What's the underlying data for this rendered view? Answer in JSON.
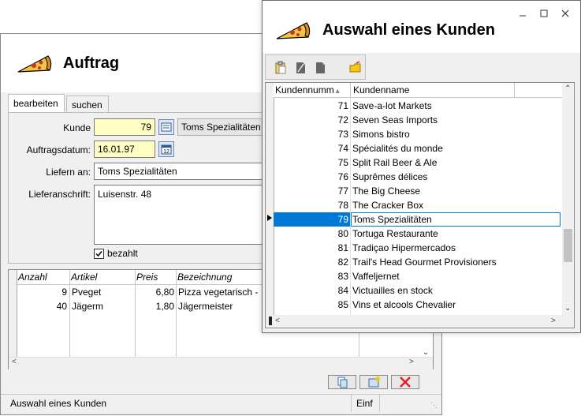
{
  "auftrag": {
    "title": "Auftrag",
    "tabs": [
      {
        "label": "bearbeiten"
      },
      {
        "label": "suchen"
      }
    ],
    "fields": {
      "kunde_label": "Kunde",
      "kunde_value": "79",
      "kunde_name": "Toms Spezialitäten",
      "datum_label": "Auftragsdatum:",
      "datum_value": "16.01.97",
      "liefern_label": "Liefern an:",
      "liefern_value": "Toms Spezialitäten",
      "anschrift_label": "Lieferanschrift:",
      "anschrift_value": "Luisenstr. 48",
      "bezahlt_label": "bezahlt",
      "bezahlt_checked": true
    },
    "grid": {
      "columns": [
        "Anzahl",
        "Artikel",
        "Preis",
        "Bezeichnung"
      ],
      "rows": [
        {
          "anzahl": "9",
          "artikel": "Pveget",
          "preis": "6,80",
          "bezeichnung": "Pizza vegetarisch -"
        },
        {
          "anzahl": "40",
          "artikel": "Jägerm",
          "preis": "1,80",
          "bezeichnung": "Jägermeister"
        }
      ]
    },
    "status": {
      "text": "Auswahl eines Kunden",
      "mode": "Einf"
    }
  },
  "kunden": {
    "title": "Auswahl eines Kunden",
    "columns": [
      "Kundennumm",
      "Kundenname"
    ],
    "selected_id": "79",
    "rows": [
      {
        "id": "71",
        "name": "Save-a-lot Markets"
      },
      {
        "id": "72",
        "name": "Seven Seas Imports"
      },
      {
        "id": "73",
        "name": "Simons bistro"
      },
      {
        "id": "74",
        "name": "Spécialités du monde"
      },
      {
        "id": "75",
        "name": "Split Rail Beer & Ale"
      },
      {
        "id": "76",
        "name": "Suprêmes délices"
      },
      {
        "id": "77",
        "name": "The Big Cheese"
      },
      {
        "id": "78",
        "name": "The Cracker Box"
      },
      {
        "id": "79",
        "name": "Toms Spezialitäten"
      },
      {
        "id": "80",
        "name": "Tortuga Restaurante"
      },
      {
        "id": "81",
        "name": "Tradiçao Hipermercados"
      },
      {
        "id": "82",
        "name": "Trail's Head Gourmet Provisioners"
      },
      {
        "id": "83",
        "name": "Vaffeljernet"
      },
      {
        "id": "84",
        "name": "Victuailles en stock"
      },
      {
        "id": "85",
        "name": "Vins et alcools Chevalier"
      }
    ],
    "window_buttons": {
      "minimize": "▫",
      "maximize": "☐",
      "close": "✕"
    }
  },
  "colors": {
    "selection": "#0078d7",
    "field_yellow": "#ffffc4",
    "delete_red": "#e02020"
  }
}
